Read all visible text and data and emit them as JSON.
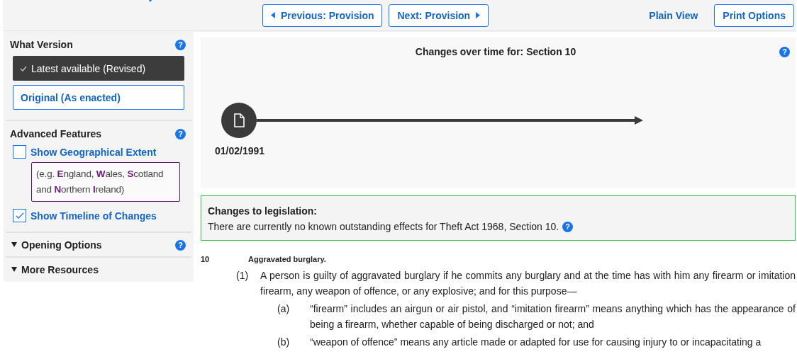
{
  "top_bar": {
    "nav_buttons": [
      {
        "label": "Previous: Provision"
      },
      {
        "label": "Next: Provision"
      }
    ],
    "plain_view": "Plain View",
    "print_options": "Print Options"
  },
  "sidebar": {
    "what_version": {
      "title": "What Version",
      "help": "?",
      "versions": [
        {
          "label": "Latest available (Revised)",
          "selected": true
        },
        {
          "label": "Original (As enacted)",
          "selected": false
        }
      ]
    },
    "advanced_features": {
      "title": "Advanced Features",
      "help": "?",
      "options": [
        {
          "label": "Show Geographical Extent",
          "checked": false,
          "note": "(e.g. **E**ngland, **W**ales, **S**cotland and **N**orthern **I**reland)"
        },
        {
          "label": "Show Timeline of Changes",
          "checked": true
        }
      ]
    },
    "sections": [
      {
        "label": "Opening Options",
        "expanded": false,
        "help": "?"
      },
      {
        "label": "More Resources",
        "expanded": false
      }
    ]
  },
  "timeline": {
    "title": "Changes over time for: Section 10",
    "help": "?",
    "points": [
      {
        "date": "01/02/1991"
      }
    ]
  },
  "changes": {
    "title": "Changes to legislation:",
    "text": "There are currently no known outstanding effects for Theft Act 1968, Section 10.",
    "help": "?"
  },
  "section": {
    "number": "10",
    "heading": "Aggravated burglary.",
    "subsections": [
      {
        "number": "(1)",
        "text": "A person is guilty of aggravated burglary if he commits any burglary and at the time has with him any firearm or imitation firearm, any weapon of offence, or any explosive; and for this purpose—",
        "paragraphs": [
          {
            "number": "(a)",
            "text": "“firearm” includes an airgun or air pistol, and “imitation firearm” means anything which has the appearance of being a firearm, whether capable of being discharged or not; and"
          },
          {
            "number": "(b)",
            "text": "“weapon of offence” means any article made or adapted for use for causing injury to or incapacitating a"
          }
        ]
      }
    ]
  }
}
